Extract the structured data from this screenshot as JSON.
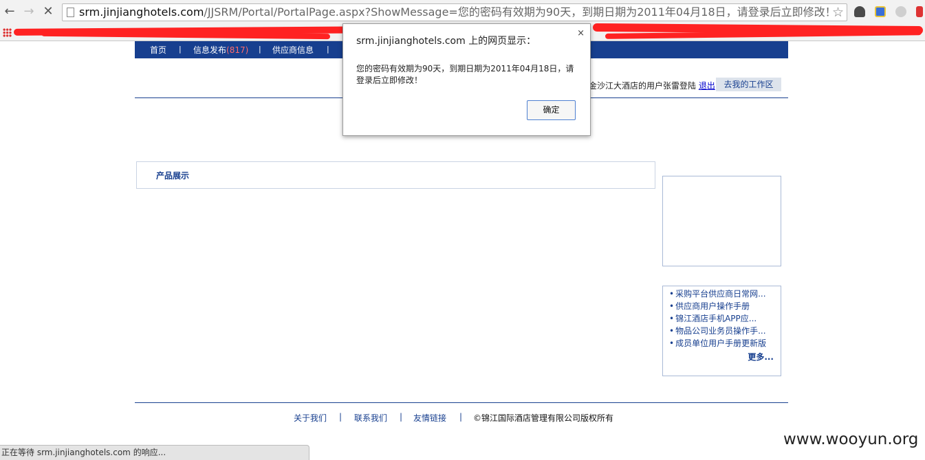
{
  "browser": {
    "url_host": "srm.jinjianghotels.com",
    "url_path": "/JJSRM/Portal/PortalPage.aspx?ShowMessage=您的密码有效期为90天，到期日期为2011年04月18日，请登录后立即修改！"
  },
  "nav": {
    "items": [
      {
        "label": "首页"
      },
      {
        "label": "信息发布",
        "badge": "(817)"
      },
      {
        "label": "供应商信息"
      }
    ],
    "separator": "|"
  },
  "header": {
    "user_text": "金沙江大酒店的用户张雷登陆",
    "logout_label": "退出",
    "workspace_label": "去我的工作区"
  },
  "main": {
    "product_title": "产品展示"
  },
  "sidebar": {
    "bullet": "•",
    "docs": [
      "采购平台供应商日常网...",
      "供应商用户操作手册",
      "锦江酒店手机APP应...",
      "物品公司业务员操作手...",
      "成员单位用户手册更新版"
    ],
    "more_label": "更多..."
  },
  "footer": {
    "links": [
      "关于我们",
      "联系我们",
      "友情链接"
    ],
    "separator": "|",
    "copyright": "©锦江国际酒店管理有限公司版权所有"
  },
  "dialog": {
    "title": "srm.jinjianghotels.com 上的网页显示：",
    "close": "×",
    "message": "您的密码有效期为90天，到期日期为2011年04月18日，请登录后立即修改！",
    "ok_label": "确定"
  },
  "status_bar": {
    "text": "正在等待 srm.jinjianghotels.com 的响应..."
  },
  "watermark": "www.wooyun.org",
  "colors": {
    "nav_blue": "#173f8f",
    "badge_red": "#ff6b6b",
    "scribble_red": "#ff2222"
  }
}
